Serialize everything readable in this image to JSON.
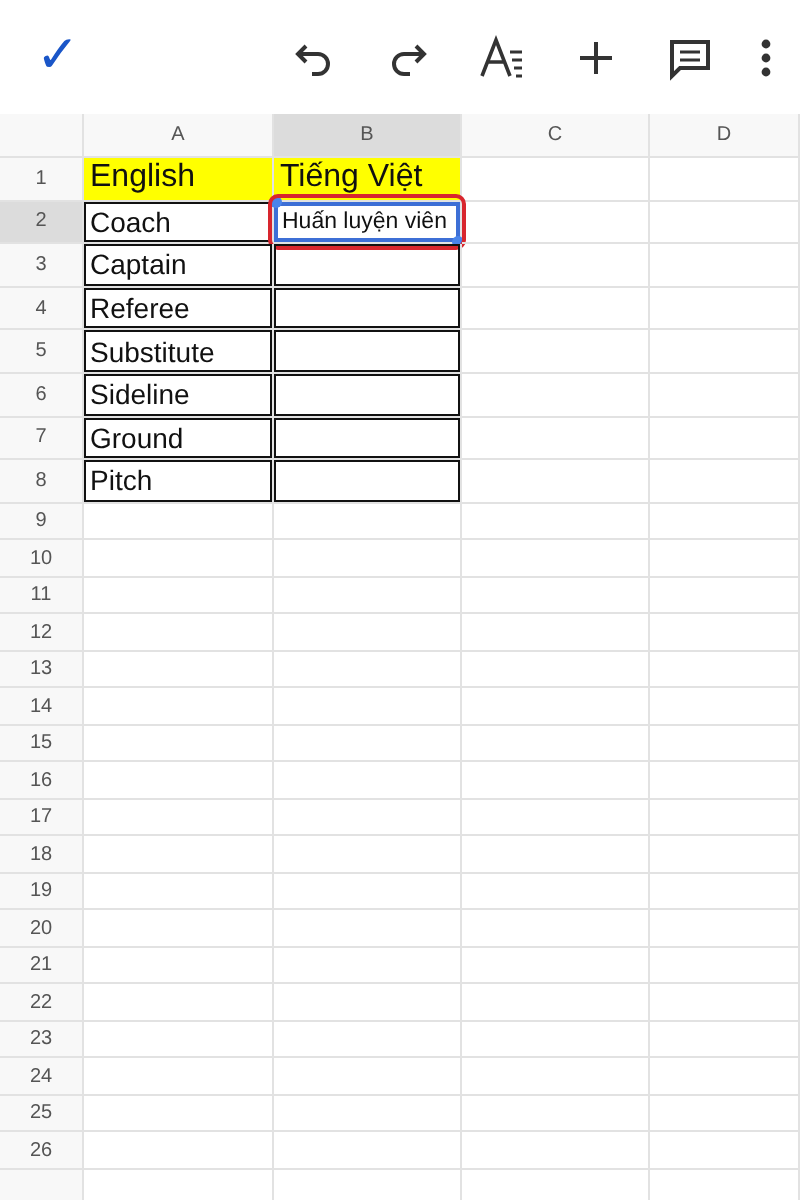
{
  "toolbar": {
    "confirm": "✓"
  },
  "columns": [
    {
      "label": "A",
      "selected": false
    },
    {
      "label": "B",
      "selected": true
    },
    {
      "label": "C",
      "selected": false
    },
    {
      "label": "D",
      "selected": false
    }
  ],
  "rows": [
    {
      "label": "1",
      "selected": false,
      "cells": [
        {
          "text": "English",
          "highlighted": true,
          "bordered": false,
          "active": false,
          "circled": false
        },
        {
          "text": "Tiếng Việt",
          "highlighted": true,
          "bordered": false,
          "active": false,
          "circled": false
        }
      ]
    },
    {
      "label": "2",
      "selected": true,
      "cells": [
        {
          "text": "Coach",
          "highlighted": false,
          "bordered": true,
          "active": false,
          "circled": false
        },
        {
          "text": "Huấn luyện viên",
          "highlighted": false,
          "bordered": true,
          "active": true,
          "circled": true
        }
      ]
    },
    {
      "label": "3",
      "selected": false,
      "cells": [
        {
          "text": "Captain",
          "highlighted": false,
          "bordered": true,
          "active": false,
          "circled": false
        },
        {
          "text": "",
          "highlighted": false,
          "bordered": true,
          "active": false,
          "circled": false
        }
      ]
    },
    {
      "label": "4",
      "selected": false,
      "cells": [
        {
          "text": "Referee",
          "highlighted": false,
          "bordered": true,
          "active": false,
          "circled": false
        },
        {
          "text": "",
          "highlighted": false,
          "bordered": true,
          "active": false,
          "circled": false
        }
      ]
    },
    {
      "label": "5",
      "selected": false,
      "cells": [
        {
          "text": "Substitute",
          "highlighted": false,
          "bordered": true,
          "active": false,
          "circled": false
        },
        {
          "text": "",
          "highlighted": false,
          "bordered": true,
          "active": false,
          "circled": false
        }
      ]
    },
    {
      "label": "6",
      "selected": false,
      "cells": [
        {
          "text": "Sideline",
          "highlighted": false,
          "bordered": true,
          "active": false,
          "circled": false
        },
        {
          "text": "",
          "highlighted": false,
          "bordered": true,
          "active": false,
          "circled": false
        }
      ]
    },
    {
      "label": "7",
      "selected": false,
      "cells": [
        {
          "text": "Ground",
          "highlighted": false,
          "bordered": true,
          "active": false,
          "circled": false
        },
        {
          "text": "",
          "highlighted": false,
          "bordered": true,
          "active": false,
          "circled": false
        }
      ]
    },
    {
      "label": "8",
      "selected": false,
      "cells": [
        {
          "text": "Pitch",
          "highlighted": false,
          "bordered": true,
          "active": false,
          "circled": false
        },
        {
          "text": "",
          "highlighted": false,
          "bordered": true,
          "active": false,
          "circled": false
        }
      ]
    },
    {
      "label": "9",
      "selected": false
    },
    {
      "label": "10",
      "selected": false
    },
    {
      "label": "11",
      "selected": false
    },
    {
      "label": "12",
      "selected": false
    },
    {
      "label": "13",
      "selected": false
    },
    {
      "label": "14",
      "selected": false
    },
    {
      "label": "15",
      "selected": false
    },
    {
      "label": "16",
      "selected": false
    },
    {
      "label": "17",
      "selected": false
    },
    {
      "label": "18",
      "selected": false
    },
    {
      "label": "19",
      "selected": false
    },
    {
      "label": "20",
      "selected": false
    },
    {
      "label": "21",
      "selected": false
    },
    {
      "label": "22",
      "selected": false
    },
    {
      "label": "23",
      "selected": false
    },
    {
      "label": "24",
      "selected": false
    },
    {
      "label": "25",
      "selected": false
    },
    {
      "label": "26",
      "selected": false
    }
  ]
}
